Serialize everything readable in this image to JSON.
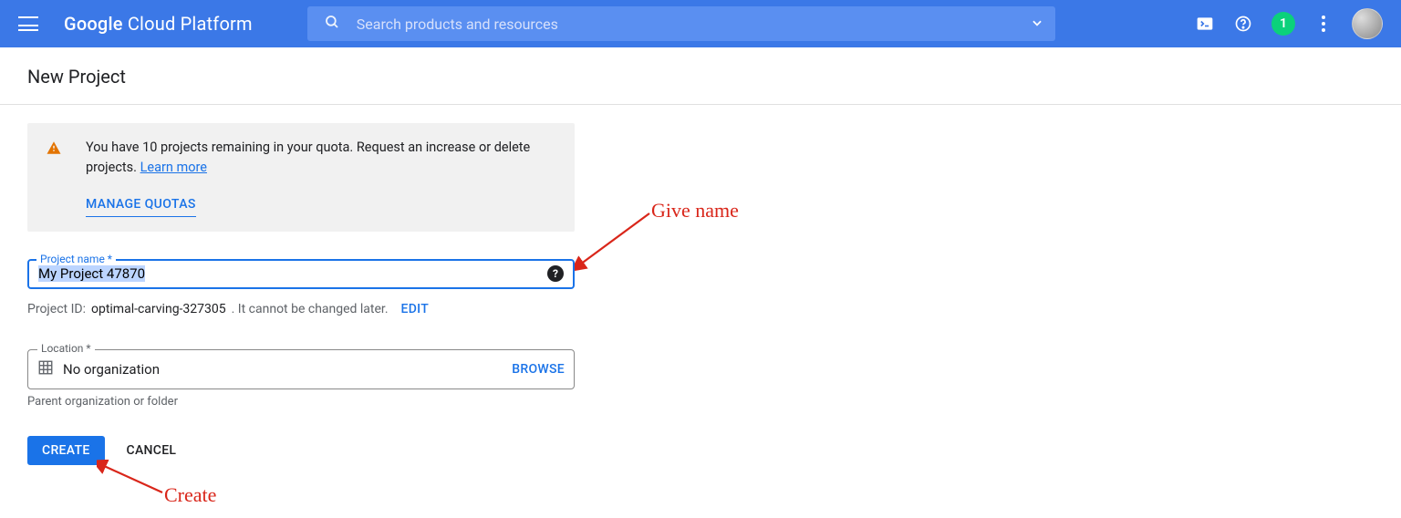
{
  "header": {
    "brand_google": "Google",
    "brand_rest": " Cloud Platform",
    "search_placeholder": "Search products and resources",
    "notif_count": "1"
  },
  "page": {
    "title": "New Project",
    "notice_text": "You have 10 projects remaining in your quota. Request an increase or delete projects. ",
    "learn_more": "Learn more",
    "manage_quotas": "MANAGE QUOTAS",
    "project_name_label": "Project name *",
    "project_name_value": "My Project 47870",
    "project_id_prefix": "Project ID: ",
    "project_id_value": "optimal-carving-327305",
    "project_id_suffix": ". It cannot be changed later.",
    "edit_label": "EDIT",
    "location_label": "Location *",
    "location_value": "No organization",
    "browse_label": "BROWSE",
    "location_helper": "Parent organization or folder",
    "create_label": "CREATE",
    "cancel_label": "CANCEL"
  },
  "annotations": {
    "give_name": "Give name",
    "create": "Create"
  }
}
